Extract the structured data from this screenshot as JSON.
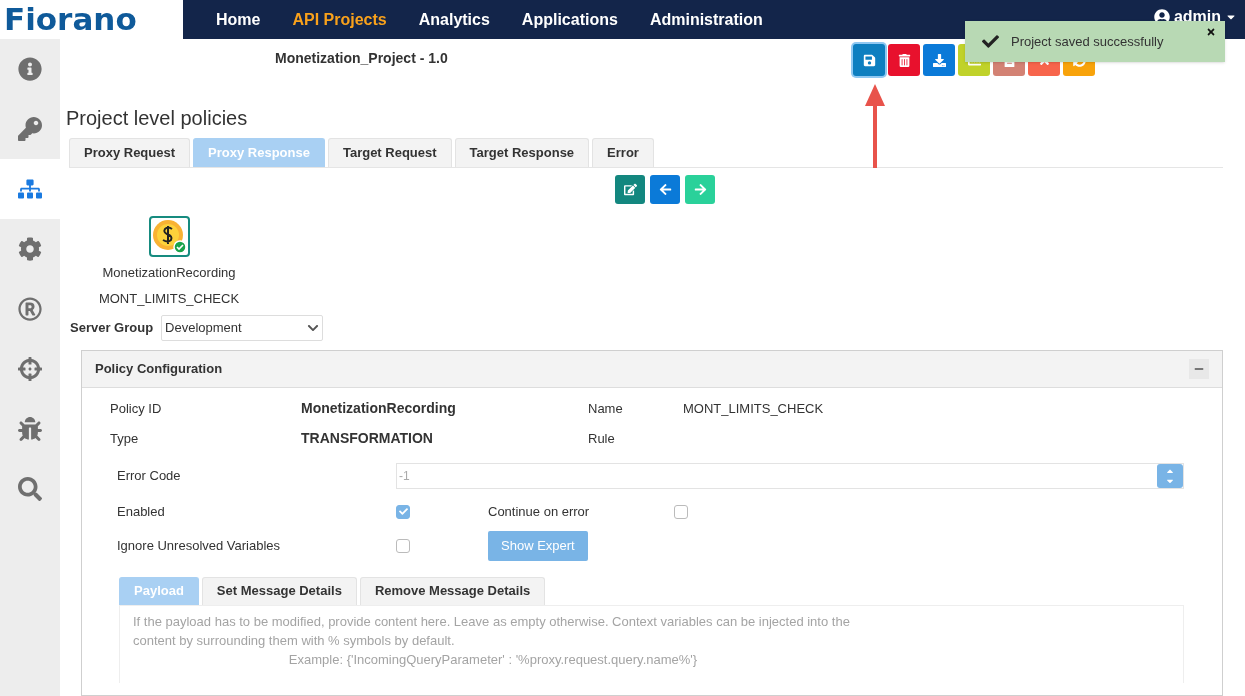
{
  "nav": {
    "logo": "Fiorano",
    "items": [
      {
        "label": "Home",
        "selected": false
      },
      {
        "label": "API Projects",
        "selected": true
      },
      {
        "label": "Analytics",
        "selected": false
      },
      {
        "label": "Applications",
        "selected": false
      },
      {
        "label": "Administration",
        "selected": false
      }
    ],
    "user": "admin"
  },
  "sidebar": {
    "items": [
      {
        "selected": false
      },
      {
        "selected": false
      },
      {
        "selected": true
      },
      {
        "selected": false
      },
      {
        "selected": false
      },
      {
        "selected": false
      },
      {
        "selected": false
      },
      {
        "selected": false
      }
    ]
  },
  "project_title": "Monetization_Project - 1.0",
  "toolbar": [
    {
      "focused": true
    },
    {
      "focused": false
    },
    {
      "focused": false
    },
    {
      "focused": false
    },
    {
      "focused": false
    },
    {
      "focused": false
    },
    {
      "focused": false
    }
  ],
  "toast": {
    "message": "Project saved successfully"
  },
  "section_title": "Project level policies",
  "tabs": [
    {
      "label": "Proxy Request",
      "selected": false
    },
    {
      "label": "Proxy Response",
      "selected": true
    },
    {
      "label": "Target Request",
      "selected": false
    },
    {
      "label": "Target Response",
      "selected": false
    },
    {
      "label": "Error",
      "selected": false
    }
  ],
  "policy_node": {
    "id": "MonetizationRecording",
    "name": "MONT_LIMITS_CHECK"
  },
  "server_group": {
    "label": "Server Group",
    "value": "Development"
  },
  "config": {
    "title": "Policy Configuration",
    "expanded": true,
    "policy_id_label": "Policy ID",
    "policy_id": "MonetizationRecording",
    "name_label": "Name",
    "name": "MONT_LIMITS_CHECK",
    "type_label": "Type",
    "type": "TRANSFORMATION",
    "rule_label": "Rule",
    "error_code_label": "Error Code",
    "error_code": "-1",
    "enabled_label": "Enabled",
    "enabled": true,
    "continue_label": "Continue on error",
    "continue": false,
    "ignore_label": "Ignore Unresolved Variables",
    "ignore": false,
    "expert_button": "Show Expert",
    "subtabs": [
      {
        "label": "Payload",
        "selected": true
      },
      {
        "label": "Set Message Details",
        "selected": false
      },
      {
        "label": "Remove Message Details",
        "selected": false
      }
    ],
    "payload_placeholder_1": "If the payload has to be modified, provide content here. Leave as empty otherwise. Context variables can be injected into the content by surrounding them with % symbols by default.",
    "payload_placeholder_2": "Example: {'IncomingQueryParameter' : '%proxy.request.query.name%'}"
  }
}
